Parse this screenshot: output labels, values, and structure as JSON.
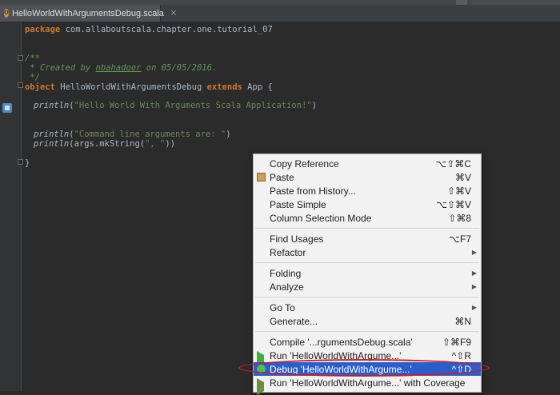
{
  "editor": {
    "tab": {
      "label": "HelloWorldWithArgumentsDebug.scala",
      "close": "×",
      "icon_letter": "O"
    },
    "code": {
      "line1": {
        "kw": "package",
        "rest": " com.allaboutscala.chapter.one.tutorial_07"
      },
      "line2": "/**",
      "line3_pre": " * Created by ",
      "line3_user": "nbahadoor",
      "line3_post": " on 05/05/2016.",
      "line4": " */",
      "line5": {
        "kw1": "object",
        "name": " HelloWorldWithArgumentsDebug ",
        "kw2": "extends",
        "rest": " App {"
      },
      "line6": {
        "fn": "println",
        "open": "(",
        "str": "\"Hello World With Arguments Scala Application!\"",
        "close": ")"
      },
      "line7": {
        "fn": "println",
        "open": "(",
        "str": "\"Command line arguments are: \"",
        "close": ")"
      },
      "line8": {
        "fn": "println",
        "mid": "(args.mkString(",
        "str": "\", \"",
        "close": "))"
      },
      "line9": "}"
    }
  },
  "context_menu": {
    "items": [
      {
        "label": "Copy Reference",
        "shortcut": "⌥⇧⌘C"
      },
      {
        "label": "Paste",
        "shortcut": "⌘V"
      },
      {
        "label": "Paste from History...",
        "shortcut": "⇧⌘V"
      },
      {
        "label": "Paste Simple",
        "shortcut": "⌥⇧⌘V"
      },
      {
        "label": "Column Selection Mode",
        "shortcut": "⇧⌘8"
      },
      {
        "label": "Find Usages",
        "shortcut": "⌥F7"
      },
      {
        "label": "Refactor",
        "shortcut": ""
      },
      {
        "label": "Folding",
        "shortcut": ""
      },
      {
        "label": "Analyze",
        "shortcut": ""
      },
      {
        "label": "Go To",
        "shortcut": ""
      },
      {
        "label": "Generate...",
        "shortcut": "⌘N"
      },
      {
        "label": "Compile '...rgumentsDebug.scala'",
        "shortcut": "⇧⌘F9"
      },
      {
        "label": "Run 'HelloWorldWithArgume...'",
        "shortcut": "^⇧R"
      },
      {
        "label": "Debug 'HelloWorldWithArgume...'",
        "shortcut": "^⇧D"
      },
      {
        "label": "Run 'HelloWorldWithArgume...' with Coverage",
        "shortcut": ""
      }
    ],
    "submenu_arrow": "▶"
  },
  "colors": {
    "selection": "#2a5ecb",
    "annotation_ring": "#d11a1a"
  }
}
